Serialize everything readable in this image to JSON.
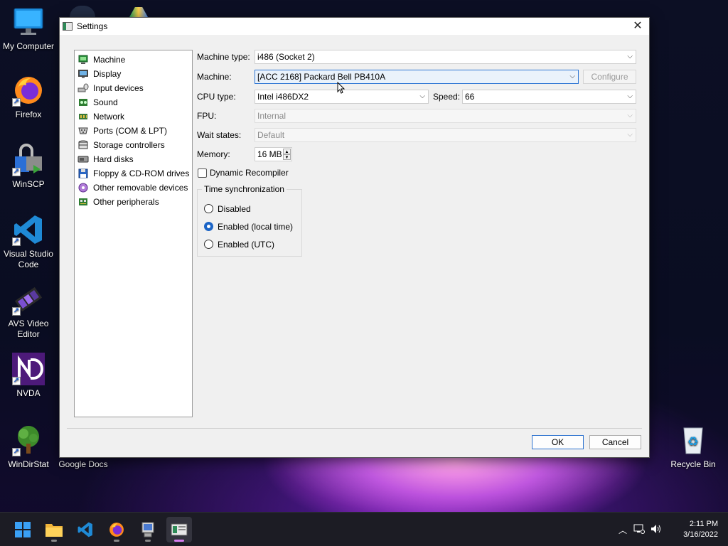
{
  "desktop": {
    "icons": [
      {
        "label": "My Computer",
        "icon": "monitor-icon"
      },
      {
        "label": "Firefox",
        "icon": "firefox-icon"
      },
      {
        "label": "WinSCP",
        "icon": "winscp-icon"
      },
      {
        "label": "Visual Studio Code",
        "icon": "vscode-icon"
      },
      {
        "label": "AVS Video Editor",
        "icon": "avs-video-icon"
      },
      {
        "label": "NVDA",
        "icon": "nvda-icon"
      },
      {
        "label": "WinDirStat",
        "icon": "windirstat-icon"
      },
      {
        "label": "Google Docs",
        "icon": "google-docs-icon"
      },
      {
        "label": "Recycle Bin",
        "icon": "recycle-bin-icon"
      }
    ]
  },
  "window": {
    "title": "Settings",
    "close_glyph": "✕"
  },
  "nav": {
    "items": [
      {
        "label": "Machine",
        "icon": "machine-icon"
      },
      {
        "label": "Display",
        "icon": "display-icon"
      },
      {
        "label": "Input devices",
        "icon": "input-devices-icon"
      },
      {
        "label": "Sound",
        "icon": "sound-icon"
      },
      {
        "label": "Network",
        "icon": "network-icon"
      },
      {
        "label": "Ports (COM & LPT)",
        "icon": "ports-icon"
      },
      {
        "label": "Storage controllers",
        "icon": "storage-controllers-icon"
      },
      {
        "label": "Hard disks",
        "icon": "hard-disks-icon"
      },
      {
        "label": "Floppy & CD-ROM drives",
        "icon": "floppy-cdrom-icon"
      },
      {
        "label": "Other removable devices",
        "icon": "removable-devices-icon"
      },
      {
        "label": "Other peripherals",
        "icon": "peripherals-icon"
      }
    ]
  },
  "machine": {
    "machine_type_label": "Machine type:",
    "machine_type_value": "i486 (Socket 2)",
    "machine_label": "Machine:",
    "machine_value": "[ACC 2168] Packard Bell PB410A",
    "configure_label": "Configure",
    "cpu_type_label": "CPU type:",
    "cpu_type_value": "Intel i486DX2",
    "speed_label": "Speed:",
    "speed_value": "66",
    "fpu_label": "FPU:",
    "fpu_value": "Internal",
    "wait_states_label": "Wait states:",
    "wait_states_value": "Default",
    "memory_label": "Memory:",
    "memory_value": "16 MB",
    "dynamic_recompiler_label": "Dynamic Recompiler",
    "dynamic_recompiler_checked": false,
    "time_sync": {
      "title": "Time synchronization",
      "options": [
        "Disabled",
        "Enabled (local time)",
        "Enabled (UTC)"
      ],
      "selected": "Enabled (local time)"
    }
  },
  "buttons": {
    "ok": "OK",
    "cancel": "Cancel"
  },
  "taskbar": {
    "apps": [
      "start-icon",
      "file-explorer-icon",
      "vscode-icon",
      "firefox-icon",
      "86box-manager-icon",
      "86box-settings-icon"
    ],
    "time": "2:11 PM",
    "date": "3/16/2022"
  },
  "colors": {
    "accent": "#1b64c6",
    "focus_border": "#3077d4",
    "taskbar_bg": "#1c1c24"
  }
}
